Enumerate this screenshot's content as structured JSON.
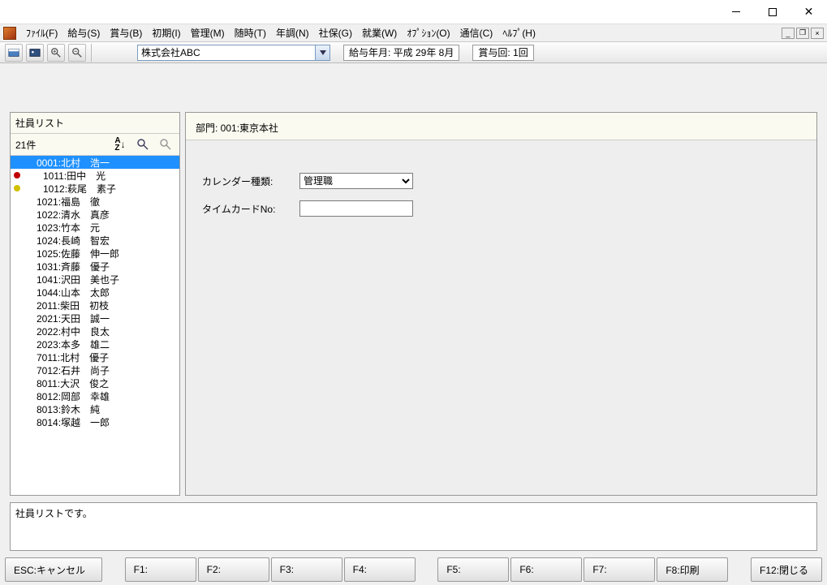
{
  "menu": {
    "items": [
      "ﾌｧｲﾙ(F)",
      "給与(S)",
      "賞与(B)",
      "初期(I)",
      "管理(M)",
      "随時(T)",
      "年調(N)",
      "社保(G)",
      "就業(W)",
      "ｵﾌﾟｼｮﾝ(O)",
      "通信(C)",
      "ﾍﾙﾌﾟ(H)"
    ]
  },
  "toolbar": {
    "company": "株式会社ABC",
    "pay_period_label": "給与年月: 平成 29年  8月",
    "bonus_label": "賞与回: 1回"
  },
  "emp_panel": {
    "title": "社員リスト",
    "count": "21件"
  },
  "employees": [
    {
      "dot": "none",
      "code": "0001",
      "name": "北村　浩一",
      "selected": true
    },
    {
      "dot": "red",
      "code": "1011",
      "name": "田中　光"
    },
    {
      "dot": "yellow",
      "code": "1012",
      "name": "萩尾　素子"
    },
    {
      "dot": "none",
      "code": "1021",
      "name": "福島　徹"
    },
    {
      "dot": "none",
      "code": "1022",
      "name": "清水　真彦"
    },
    {
      "dot": "none",
      "code": "1023",
      "name": "竹本　元"
    },
    {
      "dot": "none",
      "code": "1024",
      "name": "長崎　智宏"
    },
    {
      "dot": "none",
      "code": "1025",
      "name": "佐藤　伸一郎"
    },
    {
      "dot": "none",
      "code": "1031",
      "name": "斉藤　優子"
    },
    {
      "dot": "none",
      "code": "1041",
      "name": "沢田　美也子"
    },
    {
      "dot": "none",
      "code": "1044",
      "name": "山本　太郎"
    },
    {
      "dot": "none",
      "code": "2011",
      "name": "柴田　初枝"
    },
    {
      "dot": "none",
      "code": "2021",
      "name": "天田　誠一"
    },
    {
      "dot": "none",
      "code": "2022",
      "name": "村中　良太"
    },
    {
      "dot": "none",
      "code": "2023",
      "name": "本多　雄二"
    },
    {
      "dot": "none",
      "code": "7011",
      "name": "北村　優子"
    },
    {
      "dot": "none",
      "code": "7012",
      "name": "石井　尚子"
    },
    {
      "dot": "none",
      "code": "8011",
      "name": "大沢　俊之"
    },
    {
      "dot": "none",
      "code": "8012",
      "name": "岡部　幸雄"
    },
    {
      "dot": "none",
      "code": "8013",
      "name": "鈴木　純"
    },
    {
      "dot": "none",
      "code": "8014",
      "name": "塚越　一郎"
    }
  ],
  "detail": {
    "dept": "部門: 001:東京本社",
    "calendar_label": "カレンダー種類:",
    "calendar_value": "管理職",
    "timecard_label": "タイムカードNo:",
    "timecard_value": ""
  },
  "status": "社員リストです。",
  "fkeys": {
    "esc": "ESC:キャンセル",
    "f1": "F1:",
    "f2": "F2:",
    "f3": "F3:",
    "f4": "F4:",
    "f5": "F5:",
    "f6": "F6:",
    "f7": "F7:",
    "f8": "F8:印刷",
    "f12": "F12:閉じる"
  }
}
